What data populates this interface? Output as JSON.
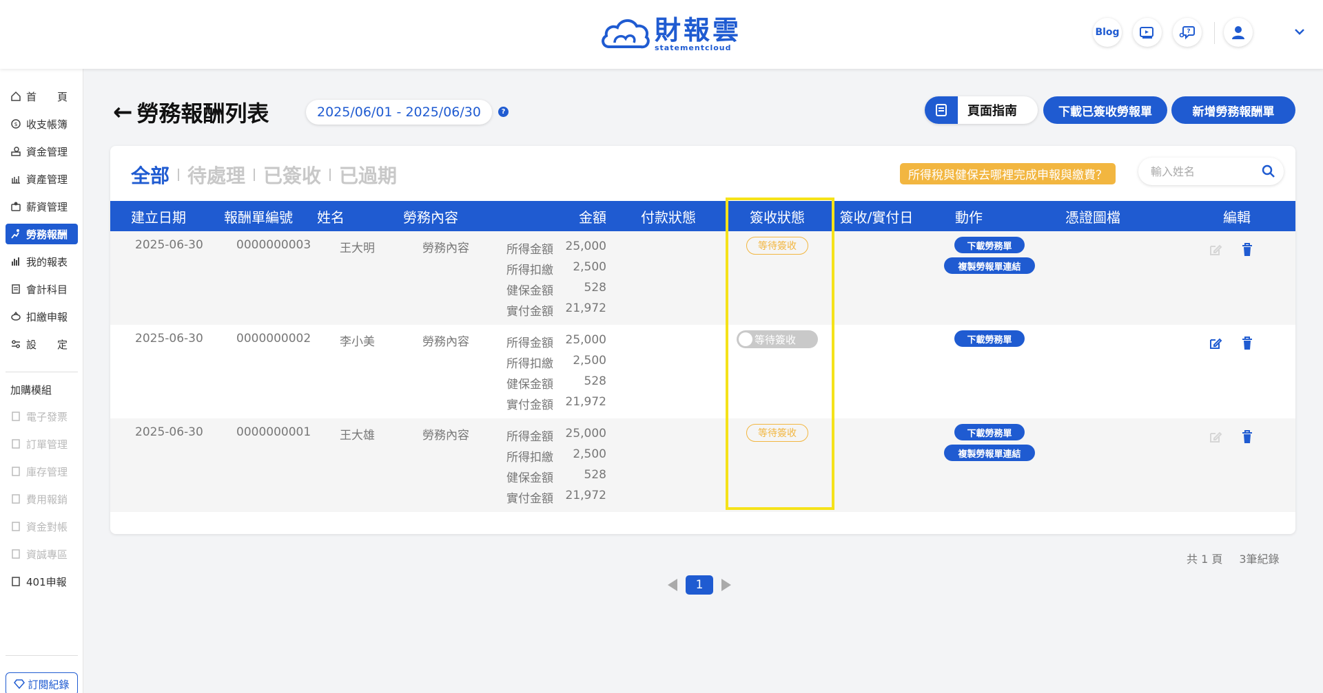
{
  "brand": {
    "name_cn": "財報雲",
    "name_en": "statementcloud",
    "color": "#1f5bd1"
  },
  "header": {
    "blog_label": "Blog"
  },
  "sidebar": {
    "items": [
      {
        "label": "首　　頁",
        "icon": "home-icon"
      },
      {
        "label": "收支帳簿",
        "icon": "coin-icon"
      },
      {
        "label": "資金管理",
        "icon": "fund-icon"
      },
      {
        "label": "資產管理",
        "icon": "asset-icon"
      },
      {
        "label": "薪資管理",
        "icon": "salary-icon"
      },
      {
        "label": "勞務報酬",
        "icon": "labor-icon",
        "active": true
      },
      {
        "label": "我的報表",
        "icon": "report-icon"
      },
      {
        "label": "會計科目",
        "icon": "ledger-icon"
      },
      {
        "label": "扣繳申報",
        "icon": "withholding-icon"
      },
      {
        "label": "設　　定",
        "icon": "settings-icon"
      }
    ],
    "section_label": "加購模組",
    "addons": [
      {
        "label": "電子發票",
        "disabled": true
      },
      {
        "label": "訂單管理",
        "disabled": true
      },
      {
        "label": "庫存管理",
        "disabled": true
      },
      {
        "label": "費用報銷",
        "disabled": true
      },
      {
        "label": "資金對帳",
        "disabled": true
      },
      {
        "label": "資誠專區",
        "disabled": true
      },
      {
        "label": "401申報",
        "disabled": false
      }
    ],
    "subscription_label": "訂閱紀錄"
  },
  "page": {
    "title": "勞務報酬列表",
    "date_range": "2025/06/01 - 2025/06/30",
    "help": "?",
    "guide_label": "頁面指南",
    "download_signed_label": "下載已簽收勞報單",
    "new_label": "新增勞務報酬單"
  },
  "tabs": [
    "全部",
    "待處理",
    "已簽收",
    "已過期"
  ],
  "tax_button_label": "所得稅與健保去哪裡完成申報與繳費？",
  "search": {
    "placeholder": "輸入姓名",
    "value": ""
  },
  "table": {
    "columns": [
      "建立日期",
      "報酬單編號",
      "姓名",
      "勞務內容",
      "金額",
      "付款狀態",
      "簽收狀態",
      "簽收/實付日",
      "動作",
      "憑證圖檔",
      "編輯"
    ],
    "amount_labels": [
      "所得金額",
      "所得扣繳",
      "健保金額",
      "實付金額"
    ],
    "rows": [
      {
        "date": "2025-06-30",
        "number": "0000000003",
        "name": "王大明",
        "content": "勞務內容",
        "amounts": [
          "25,000",
          "2,500",
          "528",
          "21,972"
        ],
        "payment_status": "",
        "sign_status": "等待簽收",
        "sign_style": "badge",
        "signed_date": "",
        "actions": [
          "下載勞務單",
          "複製勞報單連結"
        ],
        "editable": false
      },
      {
        "date": "2025-06-30",
        "number": "0000000002",
        "name": "李小美",
        "content": "勞務內容",
        "amounts": [
          "25,000",
          "2,500",
          "528",
          "21,972"
        ],
        "payment_status": "",
        "sign_status": "等待簽收",
        "sign_style": "toggle",
        "signed_date": "",
        "actions": [
          "下載勞務單"
        ],
        "editable": true
      },
      {
        "date": "2025-06-30",
        "number": "0000000001",
        "name": "王大雄",
        "content": "勞務內容",
        "amounts": [
          "25,000",
          "2,500",
          "528",
          "21,972"
        ],
        "payment_status": "",
        "sign_status": "等待簽收",
        "sign_style": "badge",
        "signed_date": "",
        "actions": [
          "下載勞務單",
          "複製勞報單連結"
        ],
        "editable": false
      }
    ]
  },
  "pagination": {
    "total_pages_text": "共 1 頁",
    "total_records_text": "3筆紀錄",
    "current_page": "1"
  },
  "colors": {
    "primary": "#1f5bd1",
    "warning": "#f2b640",
    "highlight": "#f5e21a"
  }
}
